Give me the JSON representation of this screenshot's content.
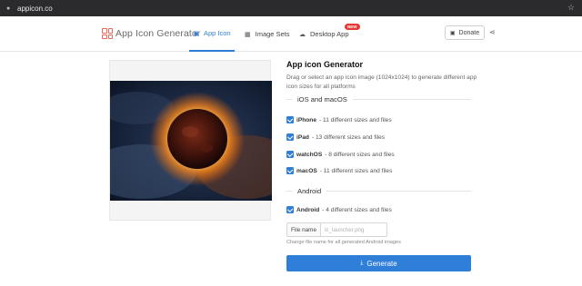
{
  "browser": {
    "url": "appicon.co"
  },
  "nav": {
    "logo_text": "App Icon Generator",
    "tabs": [
      {
        "label": "App Icon",
        "icon": "image-icon",
        "glyph": "▣"
      },
      {
        "label": "Image Sets",
        "icon": "grid-icon",
        "glyph": "▦"
      },
      {
        "label": "Desktop App",
        "icon": "cloud-icon",
        "glyph": "☁",
        "badge": "NEW"
      }
    ],
    "donate_label": "Donate",
    "accent_color": "#2f7fd8"
  },
  "main": {
    "title": "App icon Generator",
    "description": "Drag or select an app icon image (1024x1024) to generate different app icon sizes for all platforms",
    "sections": {
      "ios": "iOS and macOS",
      "android": "Android"
    },
    "options": [
      {
        "name": "iPhone",
        "detail": "- 11 different sizes and files",
        "checked": true
      },
      {
        "name": "iPad",
        "detail": "- 13 different sizes and files",
        "checked": true
      },
      {
        "name": "watchOS",
        "detail": "- 8 different sizes and files",
        "checked": true
      },
      {
        "name": "macOS",
        "detail": "- 11 different sizes and files",
        "checked": true
      },
      {
        "name": "Android",
        "detail": "- 4 different sizes and files",
        "checked": true
      }
    ],
    "file_name": {
      "label": "File name",
      "placeholder": "ic_launcher.png",
      "hint": "Change file name for all generated Android images"
    },
    "generate_label": "Generate"
  }
}
